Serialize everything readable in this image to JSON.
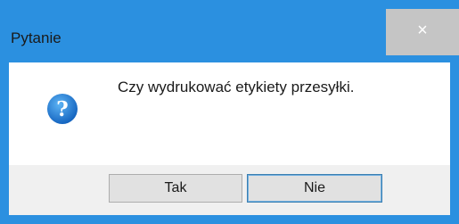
{
  "dialog": {
    "title": "Pytanie",
    "close_label": "×",
    "icon": "question-icon",
    "message": "Czy wydrukować etykiety przesyłki."
  },
  "buttons": {
    "yes_label": "Tak",
    "no_label": "Nie"
  },
  "colors": {
    "accent": "#2b90e0",
    "close_button": "#c5c5c5",
    "footer": "#f0f0f0",
    "icon": "#1e7fd6"
  }
}
